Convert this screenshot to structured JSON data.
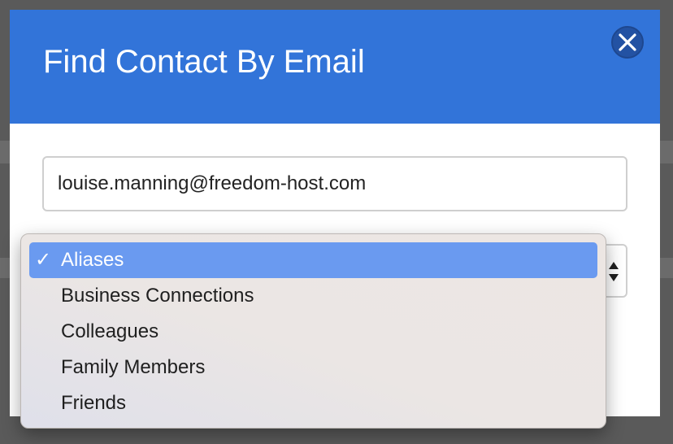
{
  "dialog": {
    "title": "Find Contact By Email",
    "close_icon": "close-icon"
  },
  "email_field": {
    "value": "louise.manning@freedom-host.com"
  },
  "group_select": {
    "selected_value": "Aliases",
    "options": [
      {
        "label": "Aliases",
        "selected": true
      },
      {
        "label": "Business Connections",
        "selected": false
      },
      {
        "label": "Colleagues",
        "selected": false
      },
      {
        "label": "Family Members",
        "selected": false
      },
      {
        "label": "Friends",
        "selected": false
      }
    ],
    "check_glyph": "✓"
  },
  "colors": {
    "header": "#3274d9",
    "close_button": "#2352a3",
    "highlight": "#6a9af0"
  }
}
